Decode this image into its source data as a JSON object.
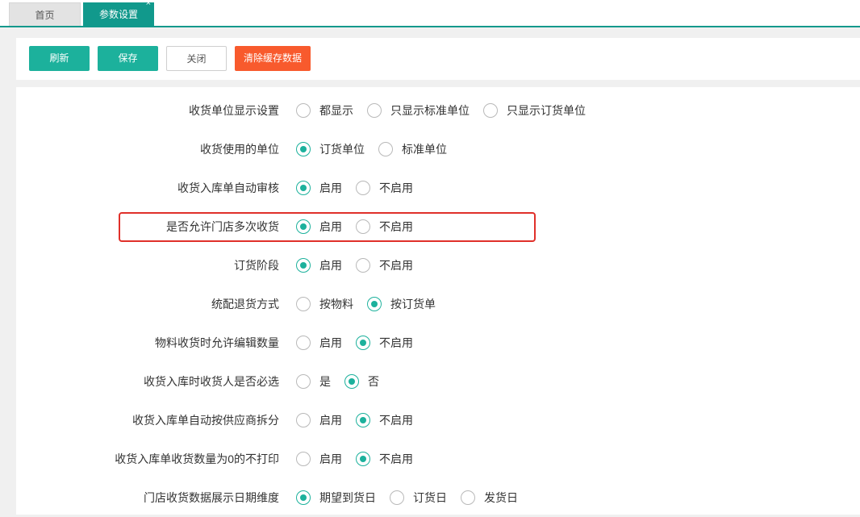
{
  "tabs": {
    "home_label": "首页",
    "active_label": "参数设置",
    "close_glyph": "×"
  },
  "toolbar": {
    "refresh_label": "刷新",
    "save_label": "保存",
    "close_label": "关闭",
    "clear_cache_label": "清除缓存数据"
  },
  "colors": {
    "accent": "#11998c",
    "button_primary": "#1cb19c",
    "button_danger": "#f85a2d",
    "highlight_border": "#e0302a"
  },
  "settings": [
    {
      "label": "收货单位显示设置",
      "options": [
        "都显示",
        "只显示标准单位",
        "只显示订货单位"
      ],
      "selected": -1
    },
    {
      "label": "收货使用的单位",
      "options": [
        "订货单位",
        "标准单位"
      ],
      "selected": 0
    },
    {
      "label": "收货入库单自动审核",
      "options": [
        "启用",
        "不启用"
      ],
      "selected": 0
    },
    {
      "label": "是否允许门店多次收货",
      "options": [
        "启用",
        "不启用"
      ],
      "selected": 0,
      "highlighted": true
    },
    {
      "label": "订货阶段",
      "options": [
        "启用",
        "不启用"
      ],
      "selected": 0
    },
    {
      "label": "统配退货方式",
      "options": [
        "按物料",
        "按订货单"
      ],
      "selected": 1
    },
    {
      "label": "物料收货时允许编辑数量",
      "options": [
        "启用",
        "不启用"
      ],
      "selected": 1
    },
    {
      "label": "收货入库时收货人是否必选",
      "options": [
        "是",
        "否"
      ],
      "selected": 1
    },
    {
      "label": "收货入库单自动按供应商拆分",
      "options": [
        "启用",
        "不启用"
      ],
      "selected": 1
    },
    {
      "label": "收货入库单收货数量为0的不打印",
      "options": [
        "启用",
        "不启用"
      ],
      "selected": 1
    },
    {
      "label": "门店收货数据展示日期维度",
      "options": [
        "期望到货日",
        "订货日",
        "发货日"
      ],
      "selected": 0
    }
  ]
}
